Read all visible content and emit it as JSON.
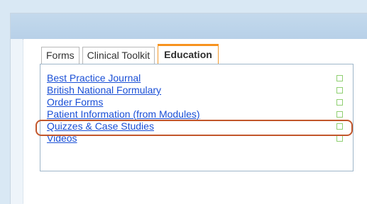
{
  "tabs": [
    {
      "label": "Forms",
      "active": false
    },
    {
      "label": "Clinical Toolkit",
      "active": false
    },
    {
      "label": "Education",
      "active": true
    }
  ],
  "links": [
    {
      "label": "Best Practice Journal"
    },
    {
      "label": "British National Formulary"
    },
    {
      "label": "Order Forms"
    },
    {
      "label": "Patient Information (from Modules)"
    },
    {
      "label": "Quizzes & Case Studies"
    },
    {
      "label": "Videos"
    }
  ],
  "colors": {
    "accent": "#f7931e",
    "link": "#1a4fd6",
    "highlight": "#c2562b",
    "checkbox": "#8fcf71"
  }
}
